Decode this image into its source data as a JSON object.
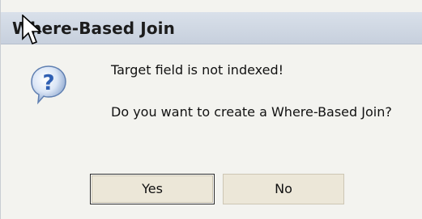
{
  "dialog": {
    "title": "Where-Based Join",
    "icon": "question-icon",
    "message_line1": "Target field is not indexed!",
    "message_line2": "Do you want to create a Where-Based Join?",
    "buttons": {
      "yes_label": "Yes",
      "no_label": "No"
    }
  },
  "colors": {
    "titlebar": "#c7d0dd",
    "dialog_background": "#f3f3ef",
    "button_face": "#ece7d8",
    "icon_blue": "#2f5fb3"
  }
}
